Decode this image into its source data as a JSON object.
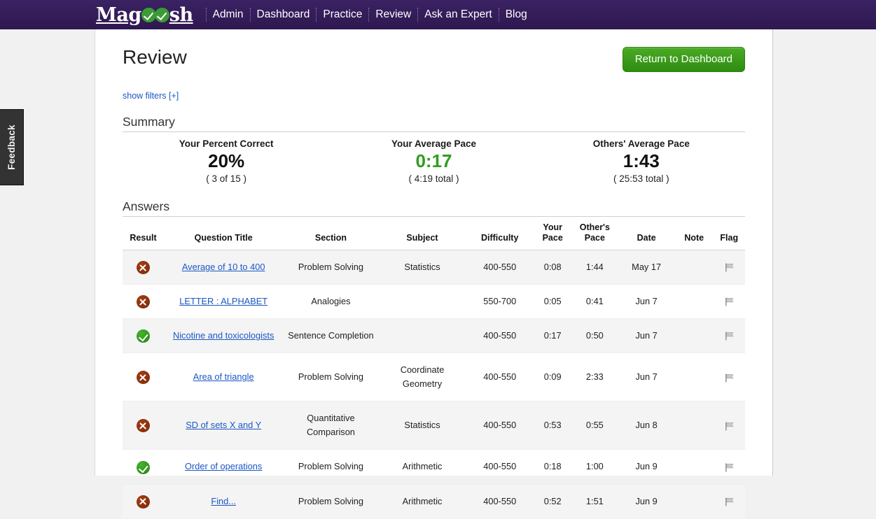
{
  "nav": {
    "logo": {
      "text_before": "Mag",
      "text_after": "sh",
      "check_icon": "check-circle-icon"
    },
    "items": [
      "Admin",
      "Dashboard",
      "Practice",
      "Review",
      "Ask an Expert",
      "Blog"
    ]
  },
  "feedback": {
    "label": "Feedback"
  },
  "header": {
    "title": "Review",
    "return_button": "Return to Dashboard",
    "show_filters": "show filters [+]"
  },
  "summary": {
    "heading": "Summary",
    "stats": [
      {
        "label": "Your Percent Correct",
        "value": "20%",
        "sub": "( 3 of 15 )",
        "green": false
      },
      {
        "label": "Your Average Pace",
        "value": "0:17",
        "sub": "( 4:19 total )",
        "green": true
      },
      {
        "label": "Others' Average Pace",
        "value": "1:43",
        "sub": "( 25:53 total )",
        "green": false
      }
    ]
  },
  "answers": {
    "heading": "Answers",
    "columns": [
      "Result",
      "Question Title",
      "Section",
      "Subject",
      "Difficulty",
      "Your Pace",
      "Other's Pace",
      "Date",
      "Note",
      "Flag"
    ],
    "columns_wrapped": [
      {
        "line1": "",
        "line2": "Result"
      },
      {
        "line1": "",
        "line2": "Question Title"
      },
      {
        "line1": "",
        "line2": "Section"
      },
      {
        "line1": "",
        "line2": "Subject"
      },
      {
        "line1": "",
        "line2": "Difficulty"
      },
      {
        "line1": "Your",
        "line2": "Pace"
      },
      {
        "line1": "Other's",
        "line2": "Pace"
      },
      {
        "line1": "",
        "line2": "Date"
      },
      {
        "line1": "",
        "line2": "Note"
      },
      {
        "line1": "",
        "line2": "Flag"
      }
    ],
    "rows": [
      {
        "result": "wrong",
        "title": "Average of 10 to 400",
        "section": "Problem Solving",
        "subject": "Statistics",
        "difficulty": "400-550",
        "your_pace": "0:08",
        "other_pace": "1:44",
        "date": "May 17",
        "note": "",
        "flag": "flag-icon"
      },
      {
        "result": "wrong",
        "title": "LETTER : ALPHABET",
        "section": "Analogies",
        "subject": "",
        "difficulty": "550-700",
        "your_pace": "0:05",
        "other_pace": "0:41",
        "date": "Jun 7",
        "note": "",
        "flag": "flag-icon"
      },
      {
        "result": "right",
        "title": "Nicotine and toxicologists",
        "section": "Sentence Completion",
        "subject": "",
        "difficulty": "400-550",
        "your_pace": "0:17",
        "other_pace": "0:50",
        "date": "Jun 7",
        "note": "",
        "flag": "flag-icon"
      },
      {
        "result": "wrong",
        "title": "Area of triangle",
        "section": "Problem Solving",
        "subject": "Coordinate Geometry",
        "difficulty": "400-550",
        "your_pace": "0:09",
        "other_pace": "2:33",
        "date": "Jun 7",
        "note": "",
        "flag": "flag-icon"
      },
      {
        "result": "wrong",
        "title": "SD of sets X and Y",
        "section": "Quantitative Comparison",
        "subject": "Statistics",
        "difficulty": "400-550",
        "your_pace": "0:53",
        "other_pace": "0:55",
        "date": "Jun 8",
        "note": "",
        "flag": "flag-icon"
      },
      {
        "result": "right",
        "title": "Order of operations",
        "section": "Problem Solving",
        "subject": "Arithmetic",
        "difficulty": "400-550",
        "your_pace": "0:18",
        "other_pace": "1:00",
        "date": "Jun 9",
        "note": "",
        "flag": "flag-icon"
      },
      {
        "result": "wrong",
        "title": "Find...",
        "section": "Problem Solving",
        "subject": "Arithmetic",
        "difficulty": "400-550",
        "your_pace": "0:52",
        "other_pace": "1:51",
        "date": "Jun 9",
        "note": "",
        "flag": "flag-icon"
      }
    ]
  },
  "colors": {
    "nav_purple": "#371e5c",
    "link_blue": "#1b57c4",
    "green": "#2f9e1e",
    "wrong_red": "#8c2f0c",
    "button_green": "#3d9b21"
  }
}
